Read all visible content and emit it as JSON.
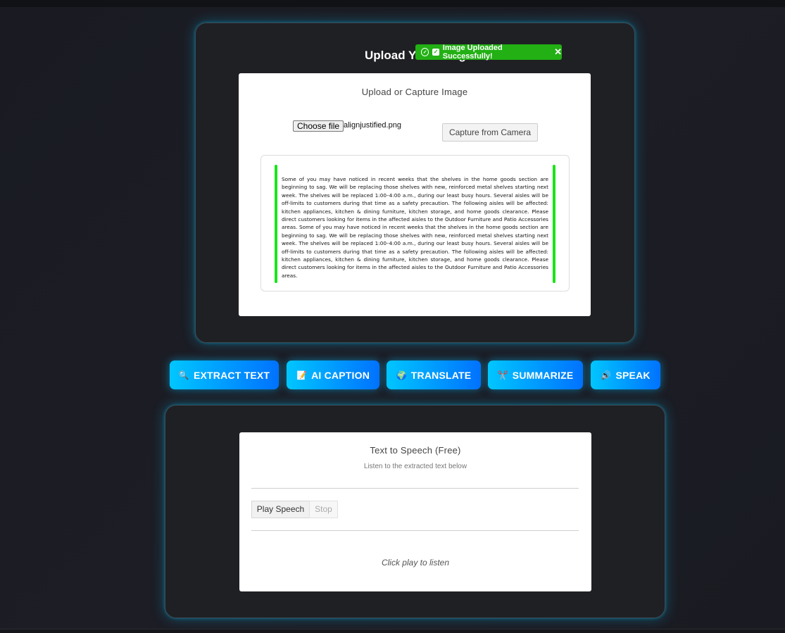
{
  "toast": {
    "message": "Image Uploaded Successfully!",
    "close": "✕"
  },
  "upload": {
    "title": "Upload Your Image",
    "card_heading": "Upload or Capture Image",
    "choose_file": "Choose file",
    "file_name": "alignjustified.png",
    "camera_button": "Capture from Camera",
    "preview_text": "Some of you may have noticed in recent weeks that the shelves in the home goods section are beginning to sag. We will be replacing those shelves with new, reinforced metal shelves starting next week. The shelves will be replaced 1:00–4:00 a.m., during our least busy hours. Several aisles will be off-limits to customers during that time as a safety precaution. The following aisles will be affected: kitchen appliances, kitchen & dining furniture, kitchen storage, and home goods clearance. Please direct customers looking for items in the affected aisles to the Outdoor Furniture and Patio Accessories areas. Some of you may have noticed in recent weeks that the shelves in the home goods section are beginning to sag. We will be replacing those shelves with new, reinforced metal shelves starting next week. The shelves will be replaced 1:00–4:00 a.m., during our least busy hours. Several aisles will be off-limits to customers during that time as a safety precaution. The following aisles will be affected: kitchen appliances, kitchen & dining furniture, kitchen storage, and home goods clearance. Please direct customers looking for items in the affected aisles to the Outdoor Furniture and Patio Accessories areas."
  },
  "actions": [
    {
      "icon": "🔍",
      "label": "EXTRACT TEXT"
    },
    {
      "icon": "📝",
      "label": "AI CAPTION"
    },
    {
      "icon": "🌍",
      "label": "TRANSLATE"
    },
    {
      "icon": "✂️",
      "label": "SUMMARIZE"
    },
    {
      "icon": "🔊",
      "label": "SPEAK"
    }
  ],
  "tts": {
    "heading": "Text to Speech (Free)",
    "subheading": "Listen to the extracted text below",
    "play_label": "Play Speech",
    "stop_label": "Stop",
    "hint": "Click play to listen"
  },
  "colors": {
    "accent_start": "#00c6ff",
    "accent_end": "#0072ff",
    "toast_green": "#22b014",
    "preview_bar": "#18e418"
  }
}
